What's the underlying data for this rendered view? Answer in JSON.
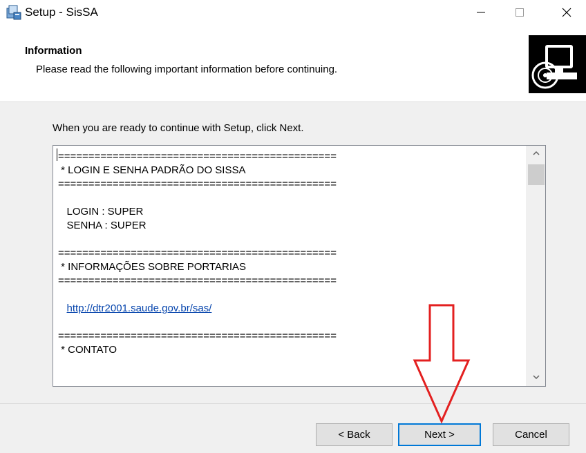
{
  "window": {
    "title": "Setup - SisSA",
    "controls": {
      "minimize": "minimize",
      "maximize": "maximize",
      "close": "close"
    }
  },
  "header": {
    "title": "Information",
    "subtitle": "Please read the following important information before continuing."
  },
  "content": {
    "instruction": "When you are ready to continue with Setup, click Next.",
    "memo_lines": [
      "==============================================",
      " * LOGIN E SENHA PADRÃO DO SISSA",
      "==============================================",
      "",
      "   LOGIN : SUPER",
      "   SENHA : SUPER",
      "",
      "==============================================",
      " * INFORMAÇÕES SOBRE PORTARIAS",
      "==============================================",
      "",
      "   http://dtr2001.saude.gov.br/sas/",
      "",
      "==============================================",
      " * CONTATO"
    ],
    "link_line_index": 11
  },
  "buttons": {
    "back": "< Back",
    "next": "Next >",
    "cancel": "Cancel"
  },
  "colors": {
    "body_bg": "#f0f0f0",
    "next_focus_border": "#0078d7",
    "link": "#0645ad",
    "annotation_arrow": "#e32020"
  },
  "icons": {
    "app": "setup-installer-icon",
    "header_image": "computer-disk-icon",
    "annotation": "red-down-arrow"
  }
}
